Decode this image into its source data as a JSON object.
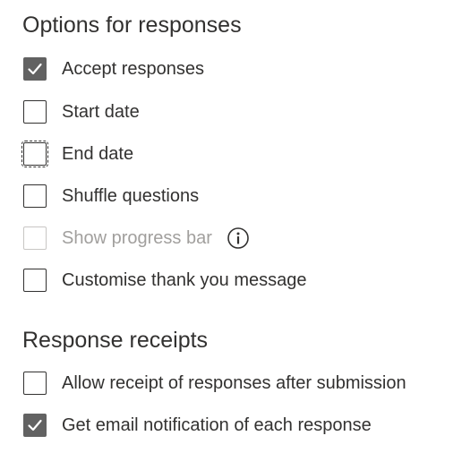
{
  "options_section": {
    "title": "Options for responses",
    "items": [
      {
        "label": "Accept responses",
        "checked": true
      },
      {
        "label": "Start date",
        "checked": false
      },
      {
        "label": "End date",
        "checked": false
      },
      {
        "label": "Shuffle questions",
        "checked": false
      },
      {
        "label": "Show progress bar",
        "checked": false,
        "disabled": true
      },
      {
        "label": "Customise thank you message",
        "checked": false
      }
    ]
  },
  "receipts_section": {
    "title": "Response receipts",
    "items": [
      {
        "label": "Allow receipt of responses after submission",
        "checked": false
      },
      {
        "label": "Get email notification of each response",
        "checked": true
      }
    ]
  },
  "icons": {
    "check": "check-icon",
    "info": "info-icon"
  },
  "colors": {
    "text": "#323130",
    "disabled_text": "#a19f9d",
    "checked_fill": "#626262",
    "disabled_border": "#c8c6c4"
  }
}
